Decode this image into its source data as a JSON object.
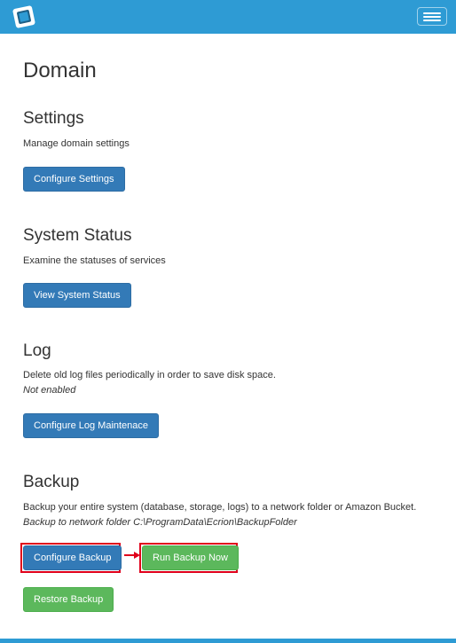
{
  "header": {
    "logo_icon": "app-logo-icon",
    "menu_icon": "hamburger-menu-icon",
    "brand_color": "#2e9bd4"
  },
  "page": {
    "title": "Domain"
  },
  "settings": {
    "title": "Settings",
    "description": "Manage domain settings",
    "button": "Configure Settings"
  },
  "system_status": {
    "title": "System Status",
    "description": "Examine the statuses of services",
    "button": "View System Status"
  },
  "log": {
    "title": "Log",
    "description": "Delete old log files periodically in order to save disk space.",
    "status": "Not enabled",
    "button": "Configure Log Maintenace"
  },
  "backup": {
    "title": "Backup",
    "description": "Backup your entire system (database, storage, logs) to a network folder or Amazon Bucket.",
    "status": "Backup to network folder C:\\ProgramData\\Ecrion\\BackupFolder",
    "configure_button": "Configure Backup",
    "run_button": "Run Backup Now",
    "restore_button": "Restore Backup",
    "highlight_color": "#e0001b"
  }
}
